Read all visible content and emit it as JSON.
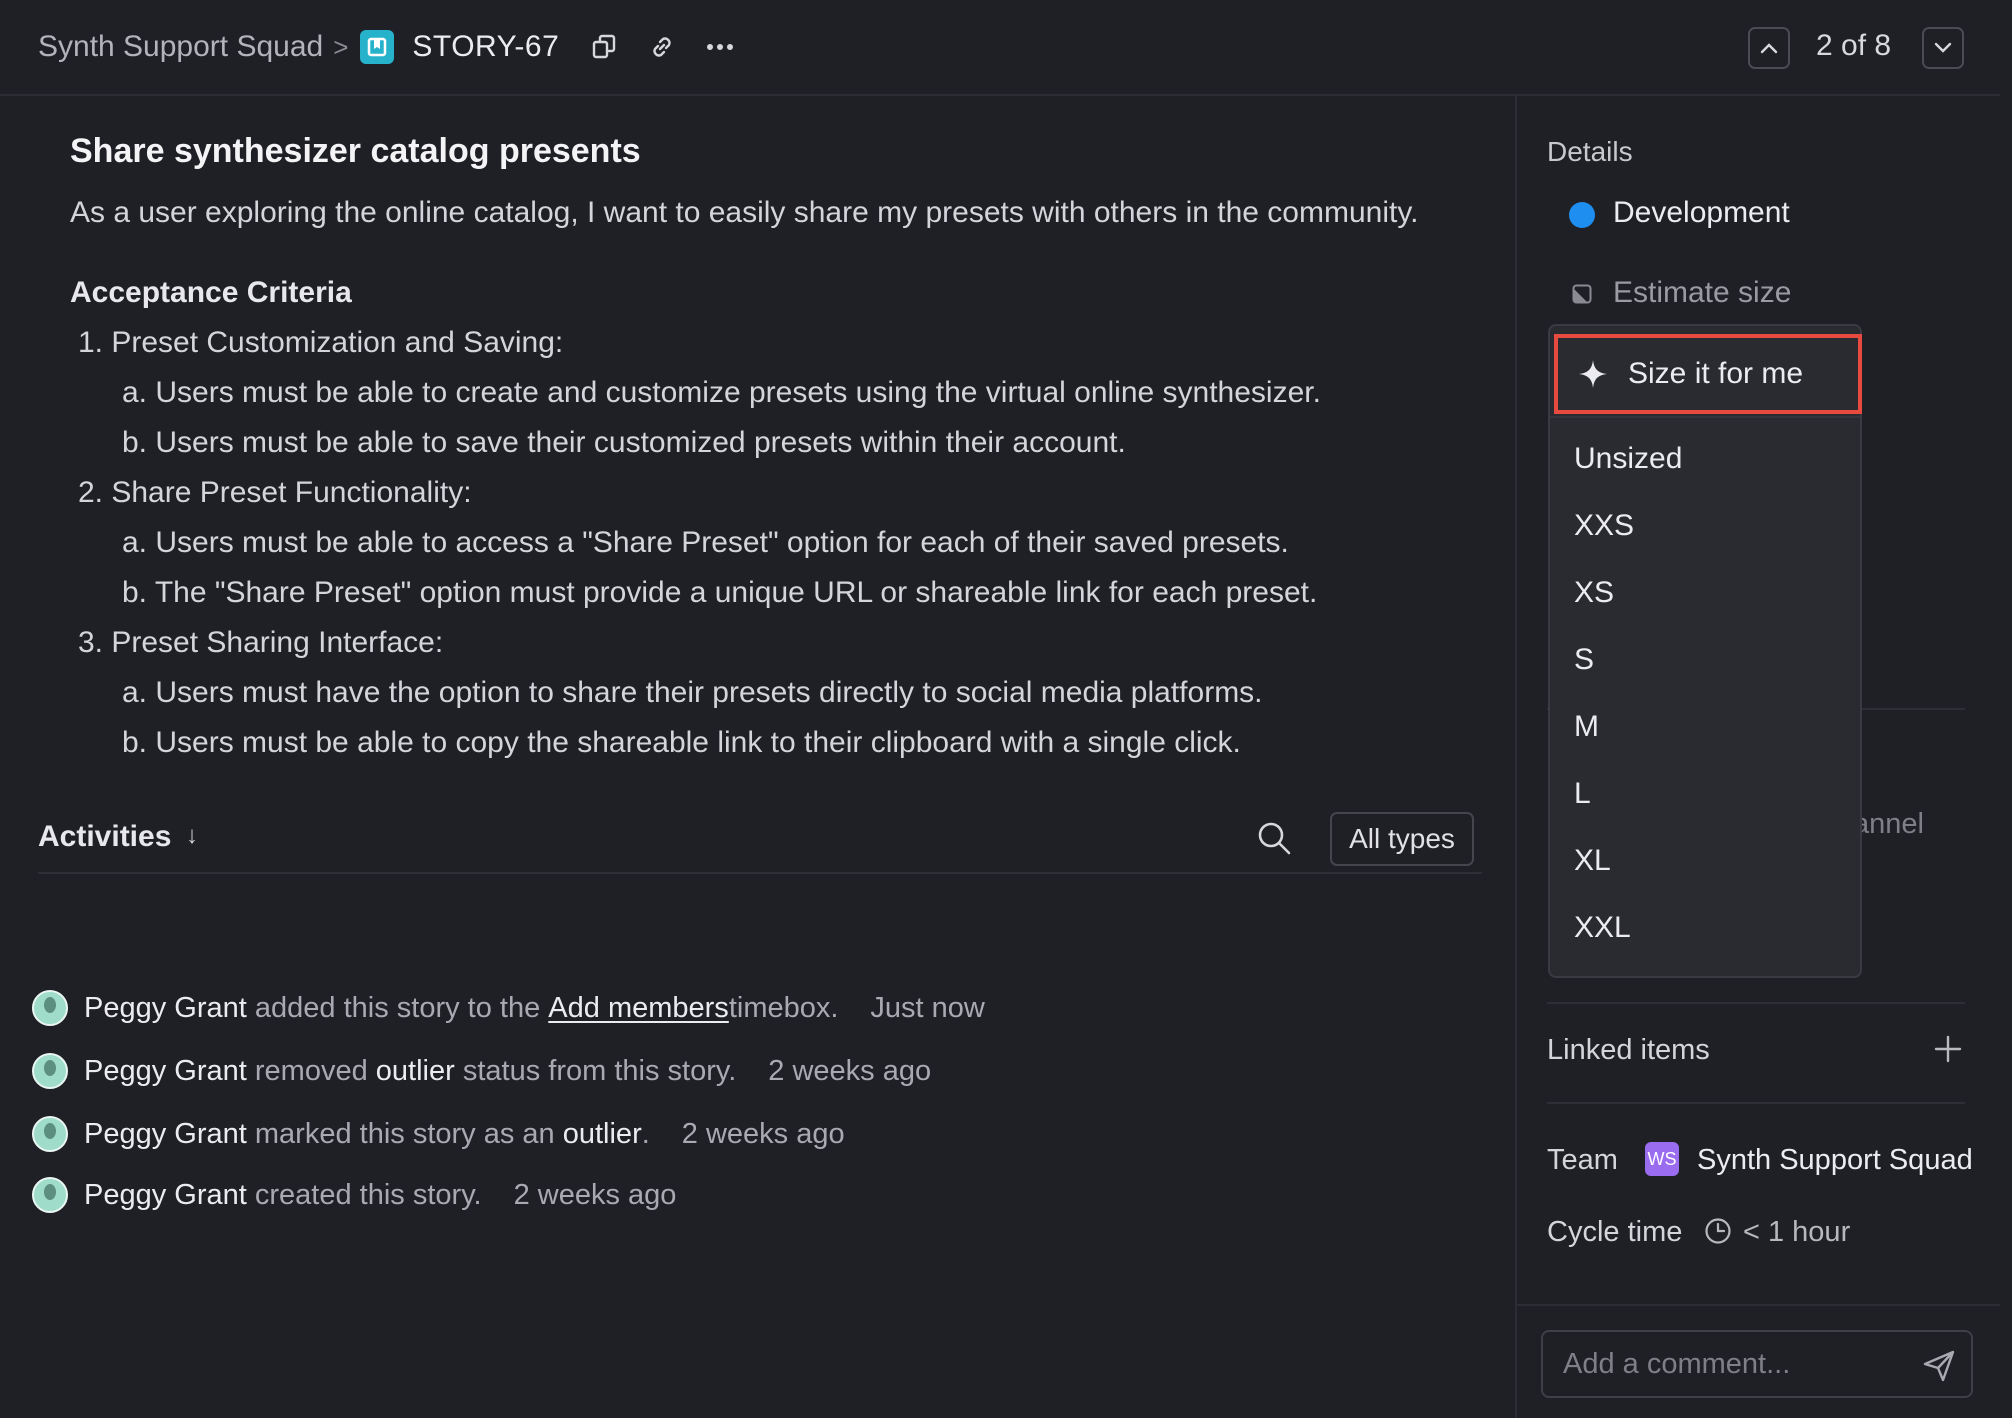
{
  "header": {
    "team": "Synth Support Squad",
    "separator": ">",
    "story_id": "STORY-67",
    "nav_position": "2 of 8"
  },
  "story": {
    "title": "Share synthesizer catalog presents",
    "description": "As a user exploring the online catalog, I want to easily share my presets with others in the community.",
    "acceptance_title": "Acceptance Criteria",
    "criteria": [
      "1. Preset Customization and Saving:",
      "a. Users must be able to create and customize presets using the virtual online synthesizer.",
      "b. Users must be able to save their customized presets within their account.",
      "2. Share Preset Functionality:",
      "a. Users must be able to access a \"Share Preset\" option for each of their saved presets.",
      "b. The \"Share Preset\" option must provide a unique URL or shareable link for each preset.",
      "3. Preset Sharing Interface:",
      "a. Users must have the option to share their presets directly to social media platforms.",
      "b. Users must be able to copy the shareable link to their clipboard with a single click."
    ]
  },
  "activities": {
    "title": "Activities",
    "sort_arrow": "↓",
    "filter_label": "All types",
    "items": [
      {
        "name": "Peggy Grant",
        "pre": " added this story to the ",
        "link": "Add members",
        "post": " timebox.",
        "time": "Just now"
      },
      {
        "name": "Peggy Grant",
        "pre": " removed ",
        "strong": "outlier",
        "post": " status from this story.",
        "time": "2 weeks ago"
      },
      {
        "name": "Peggy Grant",
        "pre": " marked this story as an ",
        "strong": "outlier",
        "post": ".",
        "time": "2 weeks ago"
      },
      {
        "name": "Peggy Grant",
        "pre": " created this story.",
        "time": "2 weeks ago"
      }
    ]
  },
  "sidebar": {
    "details_label": "Details",
    "status": "Development",
    "status_color": "#1e8ef0",
    "estimate_label": "Estimate size",
    "partial_text": "annel",
    "linked_items_label": "Linked items",
    "team_label": "Team",
    "team_badge": "WS",
    "team_name": "Synth Support Squad",
    "cycle_time_label": "Cycle time",
    "cycle_time_value": "< 1 hour",
    "comment_placeholder": "Add a comment..."
  },
  "size_dropdown": {
    "ai_option": "Size it for me",
    "highlight_color": "#e84a3f",
    "options": [
      "Unsized",
      "XXS",
      "XS",
      "S",
      "M",
      "L",
      "XL",
      "XXL"
    ]
  }
}
